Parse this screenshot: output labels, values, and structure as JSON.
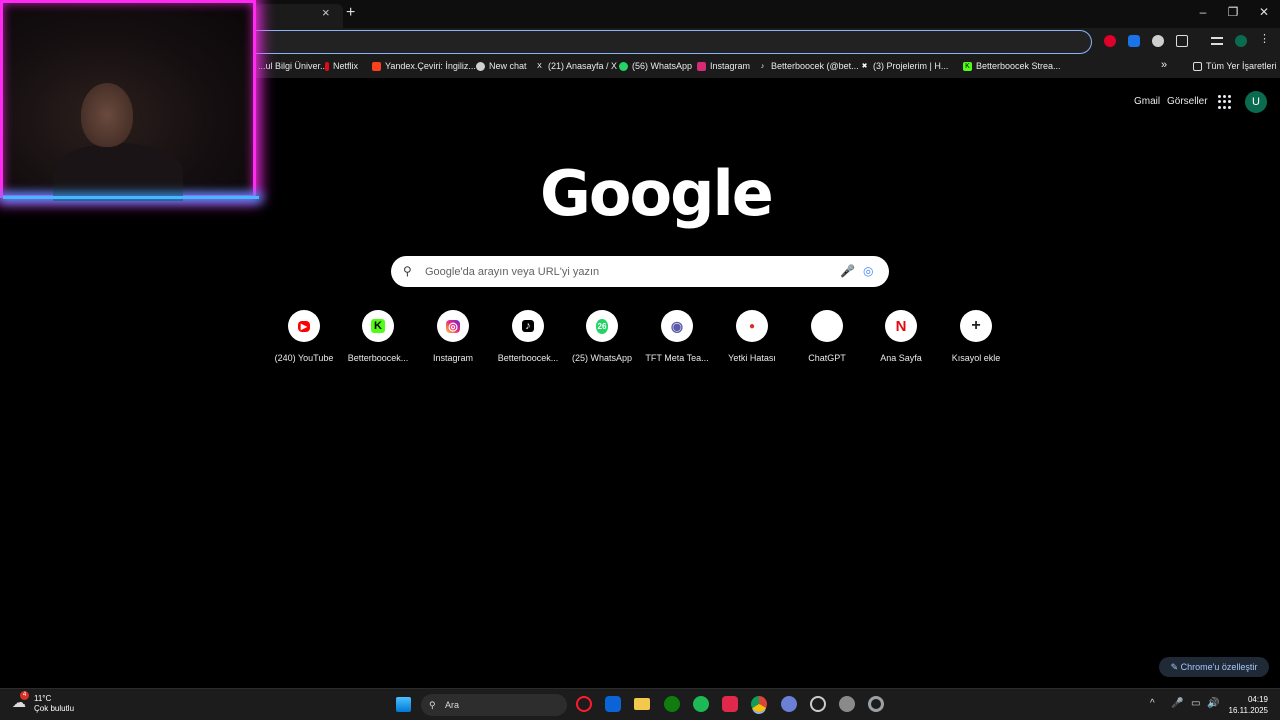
{
  "browser": {
    "tab_close": "×",
    "new_tab": "+",
    "window": {
      "minimize": "–",
      "restore": "❐",
      "close": "✕"
    }
  },
  "bookmarks": [
    {
      "label": "...ul Bilgi Üniver...",
      "color": "#4a4a4a"
    },
    {
      "label": "Netflix",
      "color": "#e50914"
    },
    {
      "label": "Yandex.Çeviri: İngiliz...",
      "color": "#fc3f1d"
    },
    {
      "label": "New chat",
      "color": "#74aa9c"
    },
    {
      "label": "(21) Anasayfa / X",
      "color": "#000000"
    },
    {
      "label": "(56) WhatsApp",
      "color": "#25d366"
    },
    {
      "label": "Instagram",
      "color": "#d62976"
    },
    {
      "label": "Betterboocek (@bet...",
      "color": "#111111"
    },
    {
      "label": "(3) Projelerim | H...",
      "color": "#222222"
    },
    {
      "label": "Betterboocek Strea...",
      "color": "#53fc18"
    }
  ],
  "bookmarks_more": "»",
  "all_bookmarks": "Tüm Yer İşaretleri",
  "header": {
    "gmail": "Gmail",
    "images": "Görseller",
    "avatar": "U"
  },
  "logo": "Google",
  "search": {
    "placeholder": "Google'da arayın veya URL'yi yazın"
  },
  "shortcuts": [
    {
      "label": "(240) YouTube",
      "icon": "▶",
      "color": "#ff0000"
    },
    {
      "label": "Betterboocek...",
      "icon": "K",
      "color": "#53fc18"
    },
    {
      "label": "Instagram",
      "icon": "◎",
      "color": "#d62976"
    },
    {
      "label": "Betterboocek...",
      "icon": "♪",
      "color": "#000000"
    },
    {
      "label": "(25) WhatsApp",
      "icon": "26",
      "color": "#25d366"
    },
    {
      "label": "TFT Meta Tea...",
      "icon": "◉",
      "color": "#5b5ba8"
    },
    {
      "label": "Yetki Hatası",
      "icon": "●",
      "color": "#d93025"
    },
    {
      "label": "ChatGPT",
      "icon": "",
      "color": "#ffffff"
    },
    {
      "label": "Ana Sayfa",
      "icon": "N",
      "color": "#e50914"
    },
    {
      "label": "Kısayol ekle",
      "icon": "+",
      "color": "#202124"
    }
  ],
  "customize": "Chrome'u özelleştir",
  "taskbar": {
    "temp": "11°C",
    "weather": "Çok bulutlu",
    "weather_badge": "4",
    "search": "Ara",
    "time": "04:19",
    "date": "16.11.2025"
  }
}
